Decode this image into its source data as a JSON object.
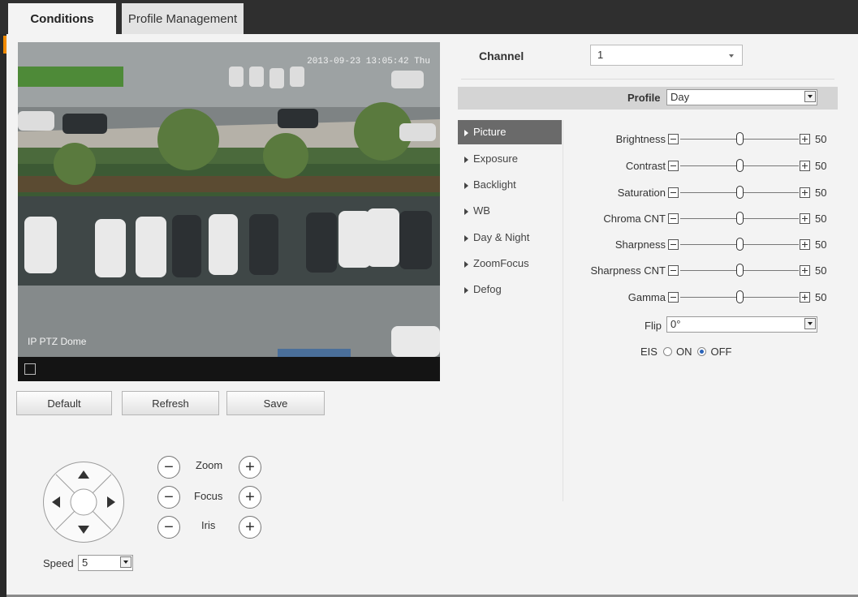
{
  "tabs": [
    {
      "label": "Conditions",
      "active": true
    },
    {
      "label": "Profile Management",
      "active": false
    }
  ],
  "video": {
    "timestamp": "2013-09-23 13:05:42 Thu",
    "camera_name": "IP PTZ Dome"
  },
  "buttons": {
    "default": "Default",
    "refresh": "Refresh",
    "save": "Save"
  },
  "ptz": {
    "zoom_label": "Zoom",
    "focus_label": "Focus",
    "iris_label": "Iris",
    "minus_glyph": "−",
    "plus_glyph": "+",
    "speed_label": "Speed",
    "speed_value": "5"
  },
  "channel": {
    "label": "Channel",
    "value": "1"
  },
  "profile": {
    "label": "Profile",
    "value": "Day"
  },
  "menu": [
    {
      "label": "Picture",
      "selected": true
    },
    {
      "label": "Exposure",
      "selected": false
    },
    {
      "label": "Backlight",
      "selected": false
    },
    {
      "label": "WB",
      "selected": false
    },
    {
      "label": "Day & Night",
      "selected": false
    },
    {
      "label": "ZoomFocus",
      "selected": false
    },
    {
      "label": "Defog",
      "selected": false
    }
  ],
  "sliders": [
    {
      "label": "Brightness",
      "value": "50",
      "level": 0.5
    },
    {
      "label": "Contrast",
      "value": "50",
      "level": 0.5
    },
    {
      "label": "Saturation",
      "value": "50",
      "level": 0.5
    },
    {
      "label": "Chroma CNT",
      "value": "50",
      "level": 0.5
    },
    {
      "label": "Sharpness",
      "value": "50",
      "level": 0.5
    },
    {
      "label": "Sharpness CNT",
      "value": "50",
      "level": 0.5
    },
    {
      "label": "Gamma",
      "value": "50",
      "level": 0.5
    }
  ],
  "flip": {
    "label": "Flip",
    "value": "0°"
  },
  "eis": {
    "label": "EIS",
    "on_label": "ON",
    "off_label": "OFF",
    "selected": "OFF"
  },
  "colors": {
    "accent": "#f08a00",
    "topbar": "#2f2f2f",
    "menu_selected": "#6a6a6a",
    "radio_selected": "#2a63b8"
  }
}
